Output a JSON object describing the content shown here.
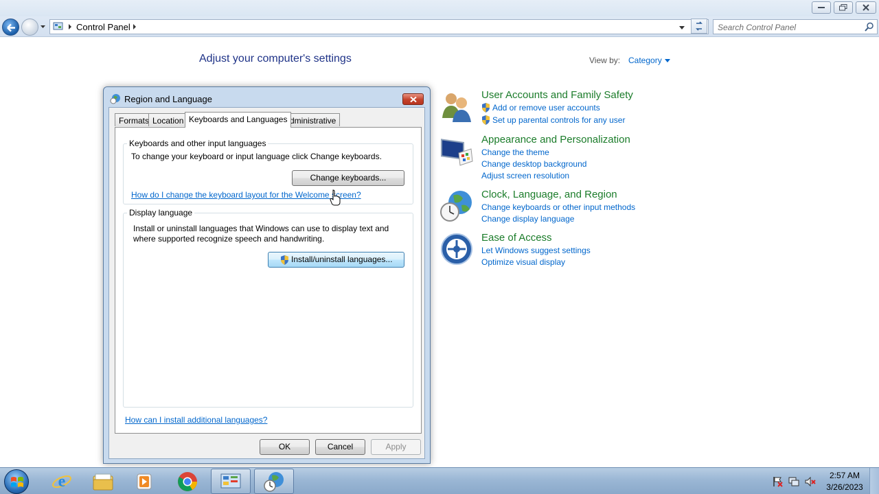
{
  "window": {
    "address": "Control Panel",
    "search_placeholder": "Search Control Panel"
  },
  "control_panel": {
    "heading": "Adjust your computer's settings",
    "view_by_label": "View by:",
    "view_by_value": "Category",
    "categories": [
      {
        "title": "User Accounts and Family Safety",
        "icon": "users-icon",
        "links": [
          "Add or remove user accounts",
          "Set up parental controls for any user"
        ]
      },
      {
        "title": "Appearance and Personalization",
        "icon": "monitor-palette-icon",
        "links": [
          "Change the theme",
          "Change desktop background",
          "Adjust screen resolution"
        ]
      },
      {
        "title": "Clock, Language, and Region",
        "icon": "clock-globe-icon",
        "links": [
          "Change keyboards or other input methods",
          "Change display language"
        ]
      },
      {
        "title": "Ease of Access",
        "icon": "ease-of-access-icon",
        "links": [
          "Let Windows suggest settings",
          "Optimize visual display"
        ]
      }
    ]
  },
  "dialog": {
    "title": "Region and Language",
    "tabs": [
      "Formats",
      "Location",
      "Keyboards and Languages",
      "Administrative"
    ],
    "active_tab": "Keyboards and Languages",
    "keyboards_group": {
      "label": "Keyboards and other input languages",
      "description": "To change your keyboard or input language click Change keyboards.",
      "button": "Change keyboards...",
      "link": "How do I change the keyboard layout for the Welcome screen?"
    },
    "display_group": {
      "label": "Display language",
      "description_line1": "Install or uninstall languages that Windows can use to display text and",
      "description_line2": "where supported recognize speech and handwriting.",
      "button": "Install/uninstall languages..."
    },
    "bottom_link": "How can I install additional languages?",
    "buttons": {
      "ok": "OK",
      "cancel": "Cancel",
      "apply": "Apply"
    }
  },
  "taskbar": {
    "apps": [
      "internet-explorer-icon",
      "windows-explorer-icon",
      "media-player-icon",
      "chrome-icon",
      "control-panel-icon",
      "region-language-icon"
    ],
    "clock_time": "2:57 AM",
    "clock_date": "3/26/2023"
  },
  "colors": {
    "category_title": "#1b7c2a",
    "link": "#0066cc",
    "heading": "#1e3287"
  }
}
